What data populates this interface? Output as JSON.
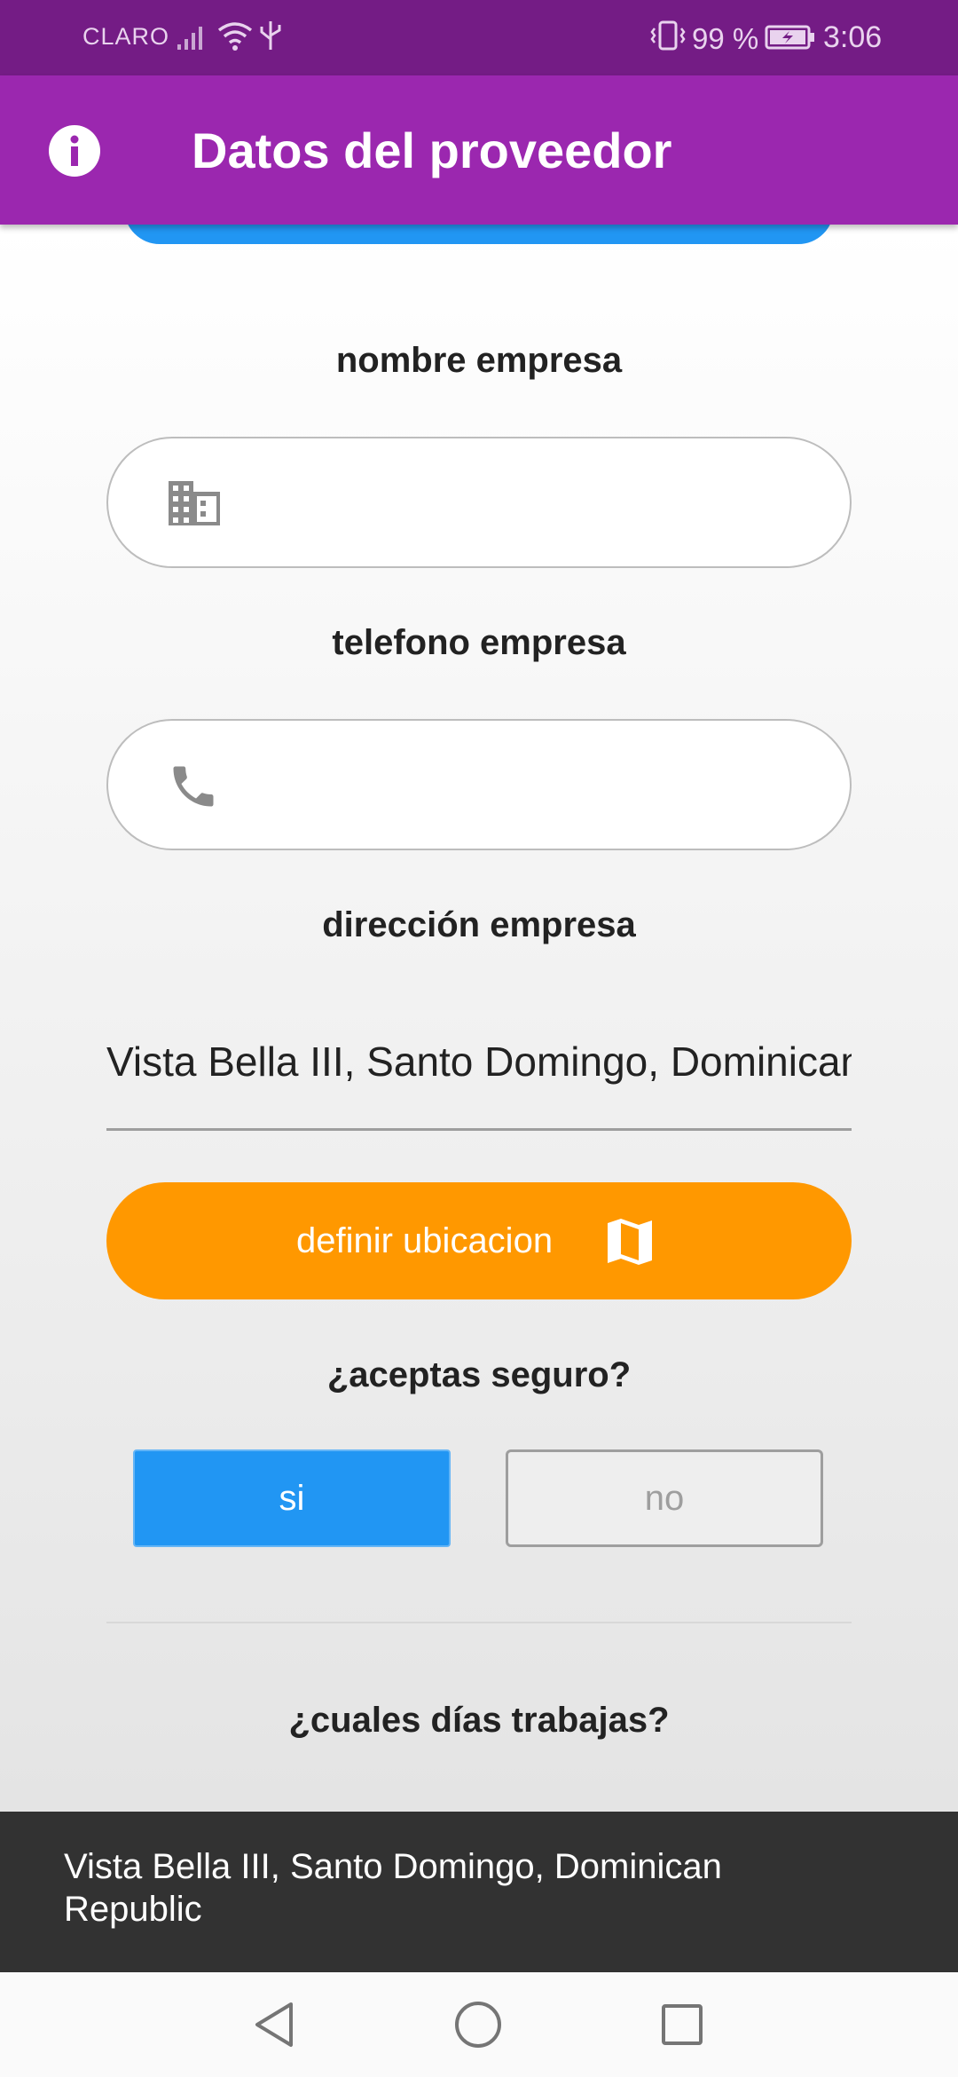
{
  "status_bar": {
    "carrier": "CLARO",
    "battery_percent": "99 %",
    "time": "3:06",
    "icons": [
      "signal-icon",
      "wifi-icon",
      "usb-icon",
      "vibrate-icon",
      "battery-icon"
    ]
  },
  "app_bar": {
    "title": "Datos del proveedor",
    "icon": "info-icon"
  },
  "form": {
    "company_name": {
      "label": "nombre empresa",
      "value": "",
      "icon": "building-icon"
    },
    "company_phone": {
      "label": "telefono empresa",
      "value": "",
      "icon": "phone-icon"
    },
    "company_address": {
      "label": "dirección empresa",
      "value": "Vista Bella III, Santo Domingo, Dominican Republic"
    },
    "location_button": {
      "label": "definir ubicacion",
      "icon": "map-icon"
    },
    "insurance": {
      "question": "¿aceptas seguro?",
      "yes_label": "si",
      "no_label": "no",
      "selected": "si"
    },
    "workdays": {
      "question": "¿cuales días trabajas?"
    }
  },
  "snackbar": {
    "message": "Vista Bella III, Santo Domingo, Dominican Republic"
  },
  "colors": {
    "status_bar": "#741c85",
    "app_bar": "#9b27af",
    "primary_blue": "#2196f3",
    "accent_orange": "#ff9800",
    "snackbar": "#323232"
  }
}
